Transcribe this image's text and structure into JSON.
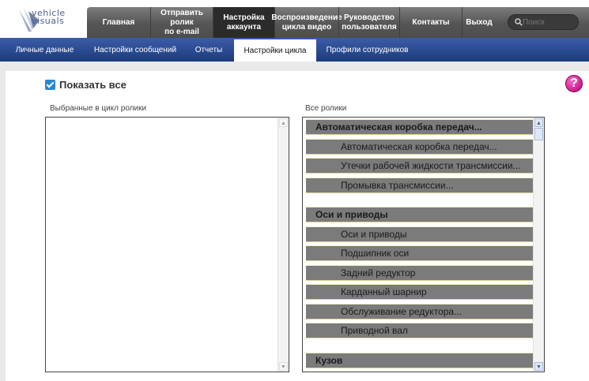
{
  "logo": {
    "line1": "vehicle",
    "line2": "visuals"
  },
  "topnav": {
    "items": [
      {
        "label": "Главная"
      },
      {
        "label": "Отправить ролик\nпо e-mail"
      },
      {
        "label": "Настройка\nаккаунта"
      },
      {
        "label": "Воспроизведение\nцикла видео"
      },
      {
        "label": "Руководство\nпользователя"
      },
      {
        "label": "Контакты"
      },
      {
        "label": "Выход"
      }
    ],
    "active": 2,
    "search_placeholder": "Поиск"
  },
  "subnav": {
    "tabs": [
      {
        "label": "Личные данные"
      },
      {
        "label": "Настройки сообщений"
      },
      {
        "label": "Отчеты"
      },
      {
        "label": "Настройки цикла"
      },
      {
        "label": "Профили сотрудников"
      }
    ],
    "active": 3
  },
  "main": {
    "show_all_label": "Показать все",
    "show_all_checked": true,
    "help_glyph": "?",
    "selected_label": "Выбранные в цикл ролики",
    "all_label": "Все ролики",
    "all_videos": [
      {
        "type": "group",
        "label": "Автоматическая коробка передач..."
      },
      {
        "type": "child",
        "label": "Автоматическая коробка передач..."
      },
      {
        "type": "child",
        "label": "Утечки рабочей жидкости трансмиссии..."
      },
      {
        "type": "child",
        "label": "Промывка трансмиссии..."
      },
      {
        "type": "spacer",
        "label": ""
      },
      {
        "type": "group",
        "label": "Оси и приводы"
      },
      {
        "type": "child",
        "label": "Оси и приводы"
      },
      {
        "type": "child",
        "label": "Подшипник оси"
      },
      {
        "type": "child",
        "label": "Задний редуктор"
      },
      {
        "type": "child",
        "label": "Карданный шарнир"
      },
      {
        "type": "child",
        "label": "Обслуживание редуктора..."
      },
      {
        "type": "child",
        "label": "Приводной вал"
      },
      {
        "type": "spacer",
        "label": ""
      },
      {
        "type": "group",
        "label": "Кузов"
      }
    ]
  },
  "colors": {
    "accent_blue": "#2a4c96",
    "list_bar": "#7b7b7b",
    "help_magenta": "#d1008f"
  }
}
